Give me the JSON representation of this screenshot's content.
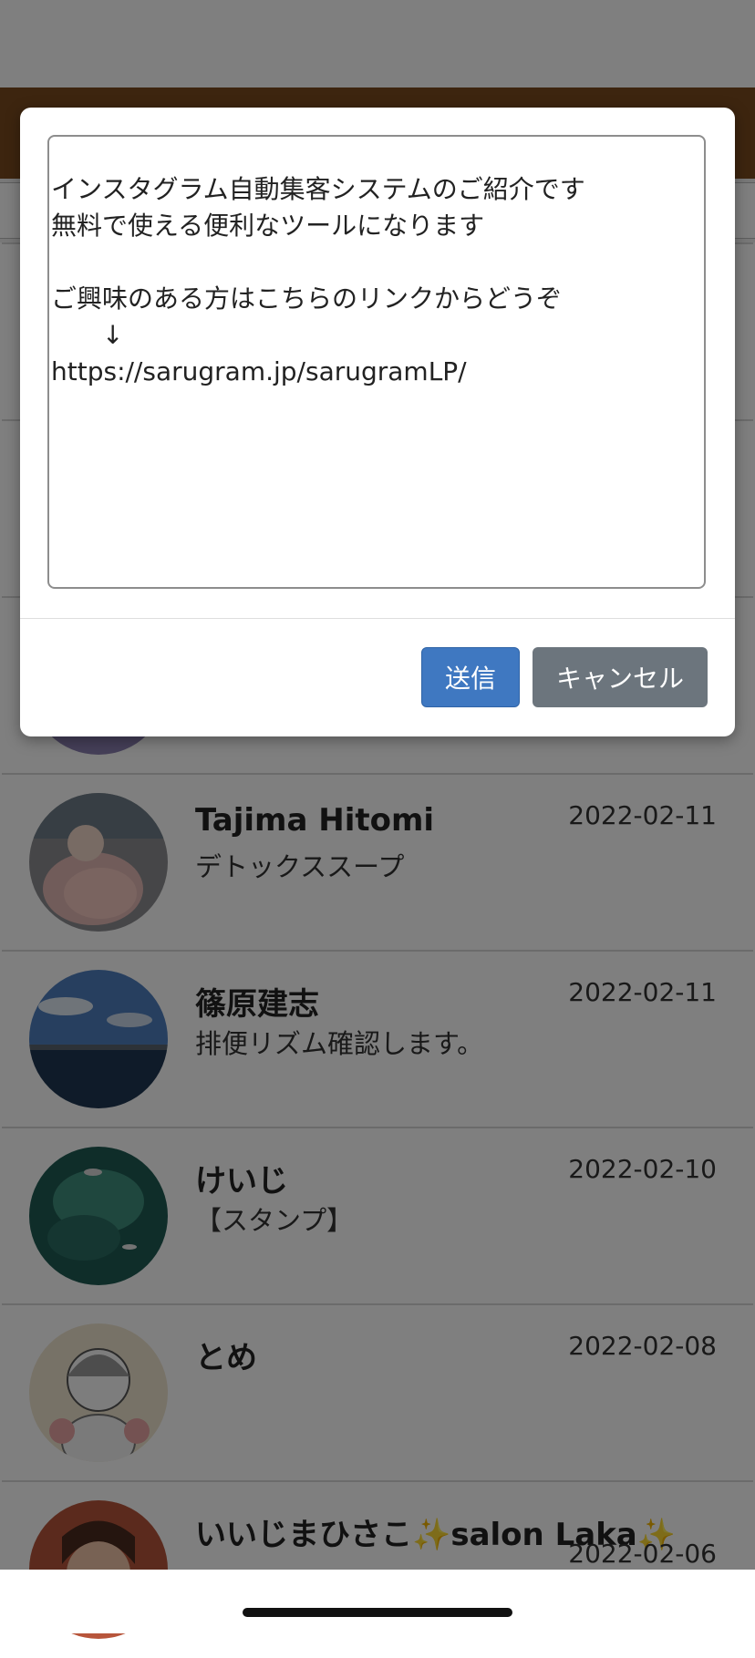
{
  "dialog": {
    "message_text": "インスタグラム自動集客システムのご紹介です\n無料で使える便利なツールになります\n\nご興味のある方はこちらのリンクからどうぞ\n　　↓\nhttps://sarugram.jp/sarugramLP/",
    "send_label": "送信",
    "cancel_label": "キャンセル"
  },
  "contacts": [
    {
      "name": "Tajima Hitomi",
      "message": "デトックススープ",
      "date": "2022-02-11",
      "avatar": "baby-photo"
    },
    {
      "name": "篠原建志",
      "message": "排便リズム確認します。",
      "date": "2022-02-11",
      "avatar": "sea-sky-photo"
    },
    {
      "name": "けいじ",
      "message": "【スタンプ】",
      "date": "2022-02-10",
      "avatar": "aquarium-photo"
    },
    {
      "name": "とめ",
      "message": "",
      "date": "2022-02-08",
      "avatar": "drawn-character"
    },
    {
      "name_prefix": "いいじまひさこ",
      "name_mid": "salon Laka",
      "name_icon": "sparkles-icon",
      "message": "",
      "date": "2022-02-06",
      "avatar": "woman-photo"
    }
  ],
  "colors": {
    "header": "#7a4a1f",
    "send_button": "#3f78c1",
    "cancel_button": "#6c757d",
    "overlay": "rgba(0,0,0,0.5)"
  }
}
